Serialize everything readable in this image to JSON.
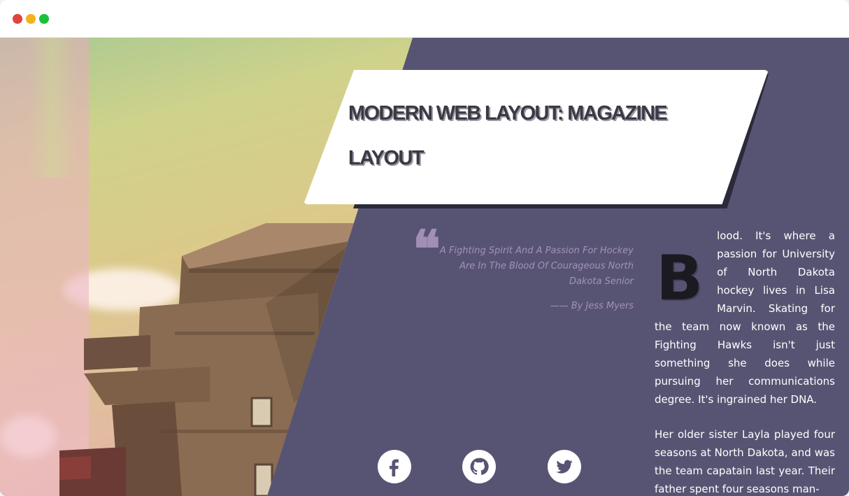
{
  "window": {
    "controls": [
      "close",
      "minimize",
      "maximize"
    ]
  },
  "title": "MODERN WEB LAYOUT: MAGAZINE LAYOUT",
  "quote": {
    "text": "A Fighting Spirit And A Passion For Hockey Are In The Blood Of Courageous North Dakota Senior",
    "author": "—— By Jess Myers"
  },
  "article": {
    "dropcap": "B",
    "paragraphs": [
      "lood. It's where a passion for University of North Dakota hockey lives in Lisa Marvin. Skating for the team now known as the Fighting Hawks isn't just something she does while pursuing her communications degree. It's ingrained her DNA.",
      "Her older sister Layla played four seasons at North Dakota, and was the team capatain last year. Their father spent four seasons man-"
    ]
  },
  "social": {
    "items": [
      {
        "icon": "facebook-icon"
      },
      {
        "icon": "github-icon"
      },
      {
        "icon": "twitter-icon"
      }
    ]
  },
  "colors": {
    "panel": "#575473",
    "quote": "#a391b8",
    "title": "#3a3a44"
  }
}
